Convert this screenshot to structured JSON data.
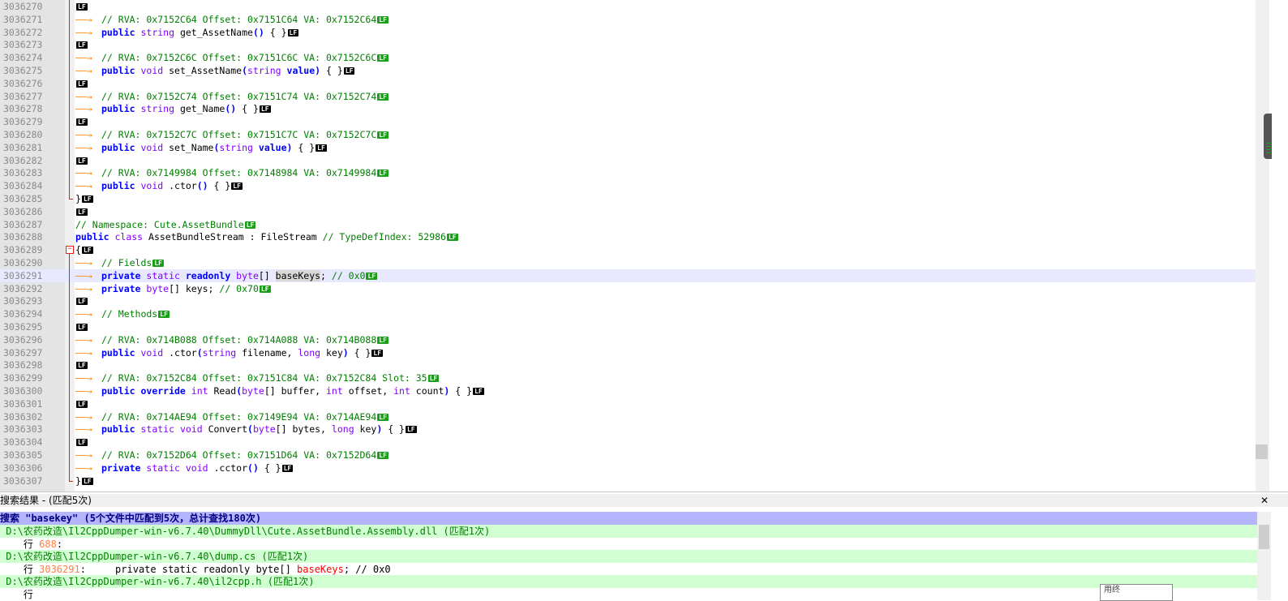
{
  "editor": {
    "lines": [
      {
        "n": "3036270",
        "kind": "blank"
      },
      {
        "n": "3036271",
        "kind": "comment",
        "text": "// RVA: 0x7152C64 Offset: 0x7151C64 VA: 0x7152C64"
      },
      {
        "n": "3036272",
        "kind": "code",
        "parts": [
          [
            "k",
            "public"
          ],
          [
            "t",
            " string"
          ],
          [
            "p",
            " get_AssetName"
          ],
          [
            "k",
            "()"
          ],
          [
            "p",
            " { }"
          ]
        ]
      },
      {
        "n": "3036273",
        "kind": "blank"
      },
      {
        "n": "3036274",
        "kind": "comment",
        "text": "// RVA: 0x7152C6C Offset: 0x7151C6C VA: 0x7152C6C"
      },
      {
        "n": "3036275",
        "kind": "code",
        "parts": [
          [
            "k",
            "public"
          ],
          [
            "t",
            " void"
          ],
          [
            "p",
            " set_AssetName"
          ],
          [
            "k",
            "("
          ],
          [
            "t",
            "string"
          ],
          [
            "k",
            " value)"
          ],
          [
            "p",
            " { }"
          ]
        ]
      },
      {
        "n": "3036276",
        "kind": "blank"
      },
      {
        "n": "3036277",
        "kind": "comment",
        "text": "// RVA: 0x7152C74 Offset: 0x7151C74 VA: 0x7152C74"
      },
      {
        "n": "3036278",
        "kind": "code",
        "parts": [
          [
            "k",
            "public"
          ],
          [
            "t",
            " string"
          ],
          [
            "p",
            " get_Name"
          ],
          [
            "k",
            "()"
          ],
          [
            "p",
            " { }"
          ]
        ]
      },
      {
        "n": "3036279",
        "kind": "blank"
      },
      {
        "n": "3036280",
        "kind": "comment",
        "text": "// RVA: 0x7152C7C Offset: 0x7151C7C VA: 0x7152C7C"
      },
      {
        "n": "3036281",
        "kind": "code",
        "parts": [
          [
            "k",
            "public"
          ],
          [
            "t",
            " void"
          ],
          [
            "p",
            " set_Name"
          ],
          [
            "k",
            "("
          ],
          [
            "t",
            "string"
          ],
          [
            "k",
            " value)"
          ],
          [
            "p",
            " { }"
          ]
        ]
      },
      {
        "n": "3036282",
        "kind": "blank"
      },
      {
        "n": "3036283",
        "kind": "comment",
        "text": "// RVA: 0x7149984 Offset: 0x7148984 VA: 0x7149984"
      },
      {
        "n": "3036284",
        "kind": "code",
        "parts": [
          [
            "k",
            "public"
          ],
          [
            "t",
            " void"
          ],
          [
            "p",
            " .ctor"
          ],
          [
            "k",
            "()"
          ],
          [
            "p",
            " { }"
          ]
        ]
      },
      {
        "n": "3036285",
        "kind": "raw",
        "text": "}"
      },
      {
        "n": "3036286",
        "kind": "raw",
        "text": ""
      },
      {
        "n": "3036287",
        "kind": "rawcomment",
        "text": "// Namespace: Cute.AssetBundle"
      },
      {
        "n": "3036288",
        "kind": "rawcode",
        "parts": [
          [
            "k",
            "public"
          ],
          [
            "t",
            " class"
          ],
          [
            "p",
            " AssetBundleStream : FileStream "
          ],
          [
            "c",
            "// TypeDefIndex: 52986"
          ]
        ]
      },
      {
        "n": "3036289",
        "kind": "raw",
        "text": "{"
      },
      {
        "n": "3036290",
        "kind": "comment",
        "text": "// Fields"
      },
      {
        "n": "3036291",
        "kind": "code",
        "hl": true,
        "parts": [
          [
            "k",
            "private"
          ],
          [
            "t",
            " static"
          ],
          [
            "k",
            " readonly"
          ],
          [
            "t",
            " byte"
          ],
          [
            "p",
            "[] "
          ],
          [
            "s",
            "baseKeys"
          ],
          [
            "p",
            "; "
          ],
          [
            "c",
            "// 0x0"
          ]
        ]
      },
      {
        "n": "3036292",
        "kind": "code",
        "parts": [
          [
            "k",
            "private"
          ],
          [
            "t",
            " byte"
          ],
          [
            "p",
            "[] keys; "
          ],
          [
            "c",
            "// 0x70"
          ]
        ]
      },
      {
        "n": "3036293",
        "kind": "blank"
      },
      {
        "n": "3036294",
        "kind": "comment",
        "text": "// Methods"
      },
      {
        "n": "3036295",
        "kind": "blank"
      },
      {
        "n": "3036296",
        "kind": "comment",
        "text": "// RVA: 0x714B088 Offset: 0x714A088 VA: 0x714B088"
      },
      {
        "n": "3036297",
        "kind": "code",
        "parts": [
          [
            "k",
            "public"
          ],
          [
            "t",
            " void"
          ],
          [
            "p",
            " .ctor"
          ],
          [
            "k",
            "("
          ],
          [
            "t",
            "string"
          ],
          [
            "p",
            " filename, "
          ],
          [
            "t",
            "long"
          ],
          [
            "p",
            " key"
          ],
          [
            "k",
            ")"
          ],
          [
            "p",
            " { }"
          ]
        ]
      },
      {
        "n": "3036298",
        "kind": "blank"
      },
      {
        "n": "3036299",
        "kind": "comment",
        "text": "// RVA: 0x7152C84 Offset: 0x7151C84 VA: 0x7152C84 Slot: 35"
      },
      {
        "n": "3036300",
        "kind": "code",
        "parts": [
          [
            "k",
            "public"
          ],
          [
            "k",
            " override"
          ],
          [
            "t",
            " int"
          ],
          [
            "p",
            " Read"
          ],
          [
            "k",
            "("
          ],
          [
            "t",
            "byte"
          ],
          [
            "p",
            "[] buffer, "
          ],
          [
            "t",
            "int"
          ],
          [
            "p",
            " offset, "
          ],
          [
            "t",
            "int"
          ],
          [
            "p",
            " count"
          ],
          [
            "k",
            ")"
          ],
          [
            "p",
            " { }"
          ]
        ]
      },
      {
        "n": "3036301",
        "kind": "blank"
      },
      {
        "n": "3036302",
        "kind": "comment",
        "text": "// RVA: 0x714AE94 Offset: 0x7149E94 VA: 0x714AE94"
      },
      {
        "n": "3036303",
        "kind": "code",
        "parts": [
          [
            "k",
            "public"
          ],
          [
            "t",
            " static"
          ],
          [
            "t",
            " void"
          ],
          [
            "p",
            " Convert"
          ],
          [
            "k",
            "("
          ],
          [
            "t",
            "byte"
          ],
          [
            "p",
            "[] bytes, "
          ],
          [
            "t",
            "long"
          ],
          [
            "p",
            " key"
          ],
          [
            "k",
            ")"
          ],
          [
            "p",
            " { }"
          ]
        ]
      },
      {
        "n": "3036304",
        "kind": "blank"
      },
      {
        "n": "3036305",
        "kind": "comment",
        "text": "// RVA: 0x7152D64 Offset: 0x7151D64 VA: 0x7152D64"
      },
      {
        "n": "3036306",
        "kind": "code",
        "parts": [
          [
            "k",
            "private"
          ],
          [
            "t",
            " static"
          ],
          [
            "t",
            " void"
          ],
          [
            "p",
            " .cctor"
          ],
          [
            "k",
            "()"
          ],
          [
            "p",
            " { }"
          ]
        ]
      },
      {
        "n": "3036307",
        "kind": "raw",
        "text": "}"
      }
    ],
    "eol_label": "LF",
    "colors": {
      "keyword": "#0000ff",
      "type": "#8000ff",
      "comment": "#008000",
      "linenum": "#8a8a8a",
      "highlight": "#e8e8ff"
    }
  },
  "results": {
    "title": "搜索结果 - (匹配5次)",
    "close": "✕",
    "search_line": "搜索 \"basekey\" (5个文件中匹配到5次，总计查找180次)",
    "items": [
      {
        "type": "file",
        "text": " D:\\农药改造\\Il2CppDumper-win-v6.7.40\\DummyDll\\Cute.AssetBundle.Assembly.dll (匹配1次)"
      },
      {
        "type": "row",
        "prefix": "    行 ",
        "num": "688",
        "rest": ":",
        "match": "",
        "after": ""
      },
      {
        "type": "file",
        "text": " D:\\农药改造\\Il2CppDumper-win-v6.7.40\\dump.cs (匹配1次)"
      },
      {
        "type": "row",
        "prefix": "    行 ",
        "num": "3036291",
        "rest": ":     private static readonly byte[] ",
        "match": "baseKeys",
        "after": "; // 0x0"
      },
      {
        "type": "file",
        "text": " D:\\农药改造\\Il2CppDumper-win-v6.7.40\\il2cpp.h (匹配1次)"
      },
      {
        "type": "row",
        "prefix": "    行 ",
        "num": "",
        "rest": "",
        "match": "",
        "after": ""
      }
    ],
    "tooltip": "用终"
  }
}
